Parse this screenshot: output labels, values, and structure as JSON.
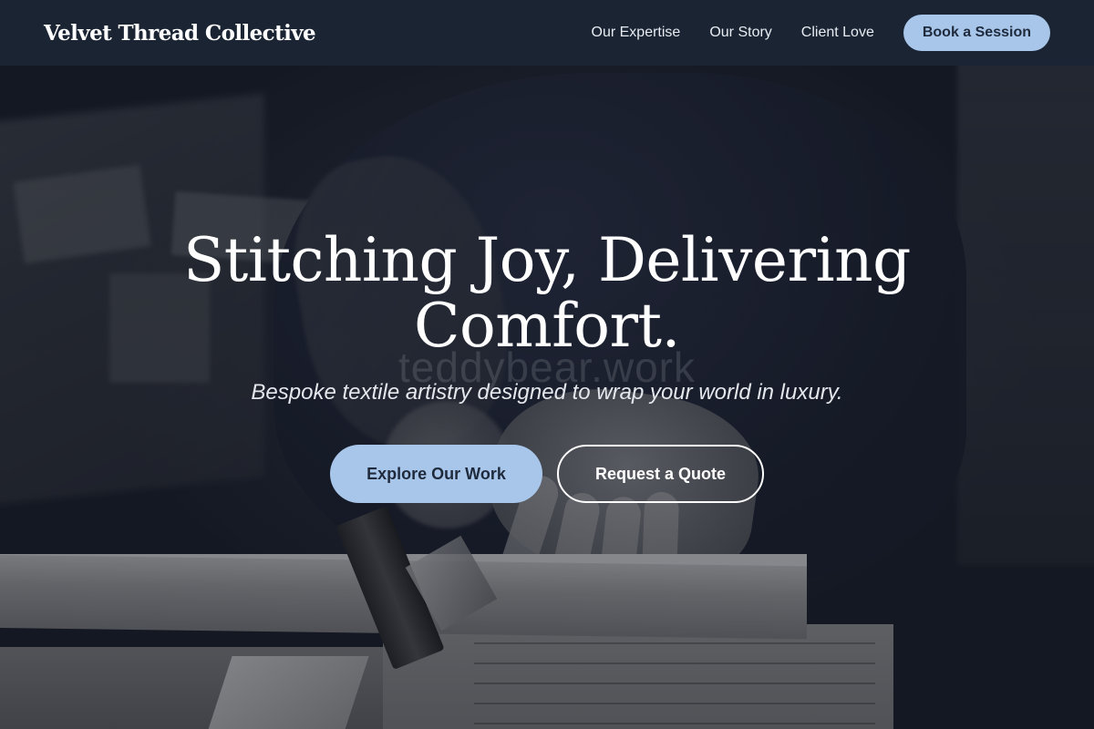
{
  "header": {
    "brand": "Velvet Thread Collective",
    "nav": [
      {
        "label": "Our Expertise"
      },
      {
        "label": "Our Story"
      },
      {
        "label": "Client Love"
      }
    ],
    "cta_label": "Book a Session"
  },
  "hero": {
    "title_line1": "Stitching Joy, Delivering",
    "title_line2": "Comfort.",
    "subtitle": "Bespoke textile artistry designed to wrap your world in luxury.",
    "watermark": "teddybear.work",
    "primary_label": "Explore Our Work",
    "secondary_label": "Request a Quote"
  },
  "colors": {
    "header_bg": "#1b2434",
    "accent": "#a8c6ea",
    "accent_text": "#1f2a3c",
    "text": "#ffffff"
  }
}
